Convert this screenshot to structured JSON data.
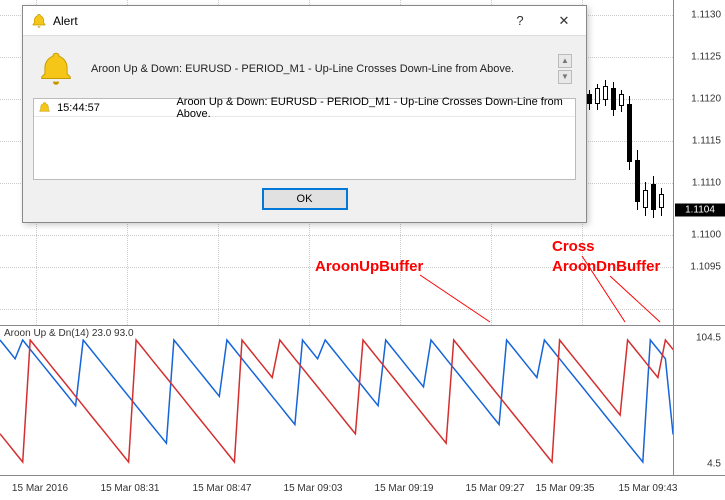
{
  "dialog": {
    "title": "Alert",
    "message": "Aroon Up & Down: EURUSD - PERIOD_M1 - Up-Line Crosses Down-Line from Above.",
    "ok_label": "OK",
    "help_label": "?",
    "close_label": "✕",
    "rows": [
      {
        "time": "15:44:57",
        "msg": "Aroon Up & Down: EURUSD - PERIOD_M1 - Up-Line Crosses Down-Line from Above."
      }
    ]
  },
  "chart": {
    "price_labels": [
      "1.1130",
      "1.1125",
      "1.1120",
      "1.1115",
      "1.1110",
      "1.1104",
      "1.1100",
      "1.1095"
    ],
    "current_price": "1.1104"
  },
  "annotations": {
    "up": "AroonUpBuffer",
    "cross": "Cross",
    "dn": "AroonDnBuffer"
  },
  "indicator": {
    "title": "Aroon Up & Dn(14) 23.0 93.0",
    "y_high": "104.5",
    "y_low": "4.5"
  },
  "time_axis": [
    "15 Mar 2016",
    "15 Mar 08:31",
    "15 Mar 08:47",
    "15 Mar 09:03",
    "15 Mar 09:19",
    "15 Mar 09:27",
    "15 Mar 09:35",
    "15 Mar 09:43"
  ],
  "chart_data": {
    "type": "line",
    "title": "Aroon Up & Dn(14)",
    "ylim": [
      4.5,
      104.5
    ],
    "x_count": 90,
    "series": [
      {
        "name": "AroonUpBuffer",
        "color": "#1565d8",
        "values": [
          100,
          93,
          86,
          100,
          93,
          86,
          79,
          72,
          65,
          58,
          51,
          100,
          93,
          86,
          79,
          72,
          65,
          58,
          51,
          44,
          37,
          30,
          23,
          100,
          93,
          86,
          79,
          72,
          65,
          58,
          100,
          93,
          86,
          79,
          72,
          65,
          58,
          51,
          44,
          37,
          100,
          93,
          86,
          100,
          93,
          86,
          79,
          72,
          65,
          58,
          51,
          100,
          93,
          86,
          79,
          72,
          65,
          100,
          93,
          86,
          79,
          72,
          65,
          58,
          51,
          44,
          37,
          100,
          93,
          86,
          79,
          72,
          100,
          93,
          86,
          79,
          72,
          65,
          58,
          51,
          44,
          37,
          30,
          23,
          16,
          9,
          100,
          93,
          86,
          30,
          23
        ]
      },
      {
        "name": "AroonDnBuffer",
        "color": "#d32f2f",
        "values": [
          30,
          23,
          16,
          9,
          100,
          93,
          86,
          79,
          72,
          65,
          58,
          51,
          44,
          37,
          30,
          23,
          16,
          9,
          100,
          93,
          86,
          79,
          72,
          65,
          58,
          51,
          44,
          37,
          30,
          23,
          16,
          9,
          100,
          93,
          86,
          79,
          72,
          100,
          93,
          86,
          79,
          72,
          65,
          58,
          51,
          44,
          37,
          30,
          100,
          93,
          86,
          79,
          72,
          65,
          58,
          51,
          44,
          37,
          30,
          23,
          100,
          93,
          86,
          79,
          72,
          65,
          58,
          51,
          44,
          37,
          30,
          23,
          16,
          9,
          100,
          93,
          86,
          79,
          72,
          65,
          58,
          51,
          44,
          100,
          93,
          86,
          79,
          72,
          100,
          93,
          93
        ]
      }
    ]
  }
}
